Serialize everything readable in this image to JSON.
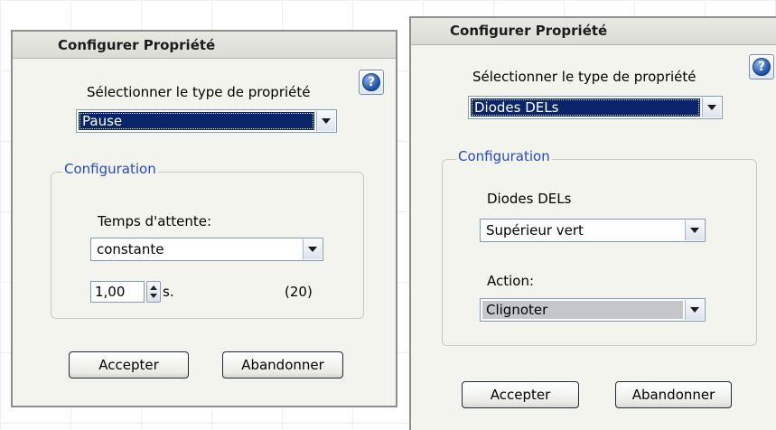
{
  "left_dialog": {
    "title": "Configurer Propriété",
    "help_icon": "?",
    "type_label": "Sélectionner le type de propriété",
    "type_value": "Pause",
    "group_title": "Configuration",
    "wait_label": "Temps d'attente:",
    "wait_mode": "constante",
    "time_value": "1,00",
    "time_unit": "s.",
    "count": "(20)",
    "accept_label": "Accepter",
    "cancel_label": "Abandonner"
  },
  "right_dialog": {
    "title": "Configurer Propriété",
    "help_icon": "?",
    "type_label": "Sélectionner le type de propriété",
    "type_value": "Diodes DELs",
    "group_title": "Configuration",
    "led_label": "Diodes DELs",
    "led_value": "Supérieur vert",
    "action_label": "Action:",
    "action_value": "Clignoter",
    "accept_label": "Accepter",
    "cancel_label": "Abandonner"
  },
  "colors": {
    "selection": "#0a246a",
    "group_title": "#2348c9",
    "dialog_bg": "#f4f4ef"
  }
}
